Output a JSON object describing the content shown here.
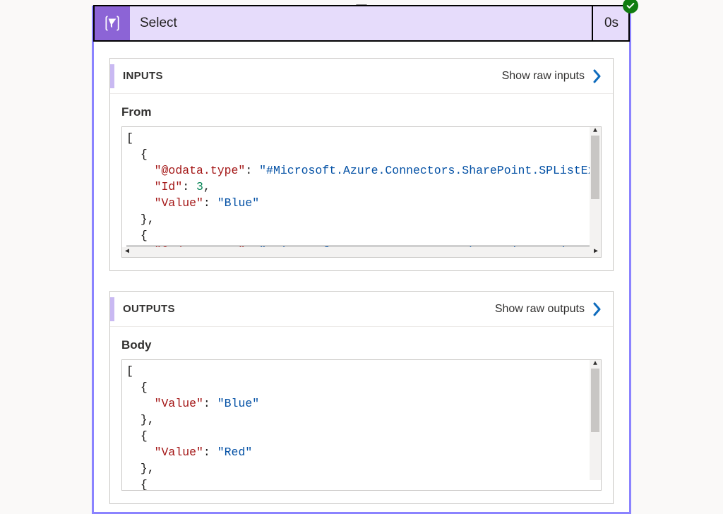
{
  "colors": {
    "card_border": "#8b83ff",
    "header_bg": "#e6dcfb",
    "header_icon_bg": "#8c64d6",
    "accent_bar": "#c9b9f2",
    "status_success": "#107c10",
    "chevron": "#0f6cbd"
  },
  "header": {
    "icon": "data-operations-icon",
    "title": "Select",
    "duration": "0s",
    "status": "success"
  },
  "inputs_panel": {
    "title": "INPUTS",
    "show_raw_label": "Show raw inputs",
    "field_label": "From",
    "json_tokens": [
      {
        "t": "punc",
        "v": "["
      },
      {
        "t": "nl"
      },
      {
        "t": "indent",
        "n": 1
      },
      {
        "t": "punc",
        "v": "{"
      },
      {
        "t": "nl"
      },
      {
        "t": "indent",
        "n": 2
      },
      {
        "t": "key",
        "v": "\"@odata.type\""
      },
      {
        "t": "punc",
        "v": ": "
      },
      {
        "t": "str",
        "v": "\"#Microsoft.Azure.Connectors.SharePoint.SPListExpand"
      },
      {
        "t": "nl"
      },
      {
        "t": "indent",
        "n": 2
      },
      {
        "t": "key",
        "v": "\"Id\""
      },
      {
        "t": "punc",
        "v": ": "
      },
      {
        "t": "num",
        "v": "3"
      },
      {
        "t": "punc",
        "v": ","
      },
      {
        "t": "nl"
      },
      {
        "t": "indent",
        "n": 2
      },
      {
        "t": "key",
        "v": "\"Value\""
      },
      {
        "t": "punc",
        "v": ": "
      },
      {
        "t": "str",
        "v": "\"Blue\""
      },
      {
        "t": "nl"
      },
      {
        "t": "indent",
        "n": 1
      },
      {
        "t": "punc",
        "v": "},"
      },
      {
        "t": "nl"
      },
      {
        "t": "indent",
        "n": 1
      },
      {
        "t": "punc",
        "v": "{"
      },
      {
        "t": "nl"
      },
      {
        "t": "indent",
        "n": 2,
        "hl": true
      },
      {
        "t": "key",
        "v": "\"@odata.type\"",
        "hl": true
      },
      {
        "t": "punc",
        "v": ": ",
        "hl": true
      },
      {
        "t": "str",
        "v": "\"#Microsoft.Azure.Connectors.SharePoint.SPListExpand",
        "hl": true
      }
    ]
  },
  "outputs_panel": {
    "title": "OUTPUTS",
    "show_raw_label": "Show raw outputs",
    "field_label": "Body",
    "json_tokens": [
      {
        "t": "punc",
        "v": "["
      },
      {
        "t": "nl"
      },
      {
        "t": "indent",
        "n": 1
      },
      {
        "t": "punc",
        "v": "{"
      },
      {
        "t": "nl"
      },
      {
        "t": "indent",
        "n": 2
      },
      {
        "t": "key",
        "v": "\"Value\""
      },
      {
        "t": "punc",
        "v": ": "
      },
      {
        "t": "str",
        "v": "\"Blue\""
      },
      {
        "t": "nl"
      },
      {
        "t": "indent",
        "n": 1
      },
      {
        "t": "punc",
        "v": "},"
      },
      {
        "t": "nl"
      },
      {
        "t": "indent",
        "n": 1
      },
      {
        "t": "punc",
        "v": "{"
      },
      {
        "t": "nl"
      },
      {
        "t": "indent",
        "n": 2
      },
      {
        "t": "key",
        "v": "\"Value\""
      },
      {
        "t": "punc",
        "v": ": "
      },
      {
        "t": "str",
        "v": "\"Red\""
      },
      {
        "t": "nl"
      },
      {
        "t": "indent",
        "n": 1
      },
      {
        "t": "punc",
        "v": "},"
      },
      {
        "t": "nl"
      },
      {
        "t": "indent",
        "n": 1
      },
      {
        "t": "punc",
        "v": "{"
      }
    ]
  }
}
